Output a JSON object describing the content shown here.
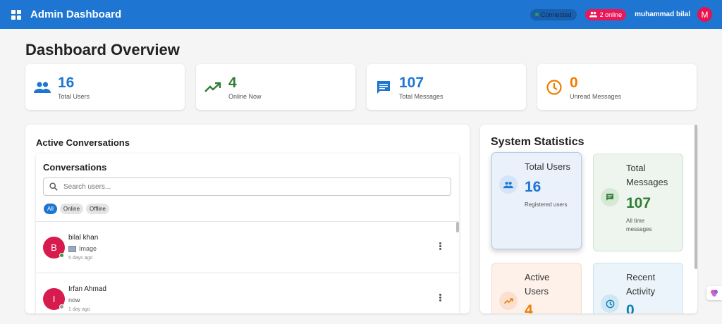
{
  "header": {
    "title": "Admin Dashboard",
    "connected_label": "Connected",
    "online_label": "2 online",
    "username": "muhammad bilal",
    "avatar_initial": "M"
  },
  "page_title": "Dashboard Overview",
  "stats": [
    {
      "value": "16",
      "label": "Total Users",
      "icon": "people-icon",
      "color": "#1e76d2"
    },
    {
      "value": "4",
      "label": "Online Now",
      "icon": "trending-up-icon",
      "color": "#2e7d32"
    },
    {
      "value": "107",
      "label": "Total Messages",
      "icon": "message-icon",
      "color": "#1e76d2"
    },
    {
      "value": "0",
      "label": "Unread Messages",
      "icon": "clock-icon",
      "color": "#ef7d00"
    }
  ],
  "active_conversations": {
    "heading": "Active Conversations",
    "box_title": "Conversations",
    "search_placeholder": "Search users...",
    "filters": [
      "All",
      "Online",
      "Offline"
    ],
    "items": [
      {
        "initial": "B",
        "name": "bilal khan",
        "message": "Image",
        "time": "5 days ago",
        "status_color": "#2e9e47"
      },
      {
        "initial": "I",
        "name": "Irfan Ahmad",
        "message": "now",
        "time": "1 day ago",
        "status_color": "#9e9e9e"
      }
    ]
  },
  "system_statistics": {
    "title": "System Statistics",
    "cards": [
      {
        "title": "Total Users",
        "value": "16",
        "subtitle": "Registered users",
        "icon": "people-icon"
      },
      {
        "title": "Total Messages",
        "value": "107",
        "subtitle": "All time messages",
        "icon": "message-icon"
      },
      {
        "title": "Active Users",
        "value": "4",
        "subtitle": "",
        "icon": "trending-up-icon"
      },
      {
        "title": "Recent Activity",
        "value": "0",
        "subtitle": "",
        "icon": "clock-icon"
      }
    ]
  }
}
